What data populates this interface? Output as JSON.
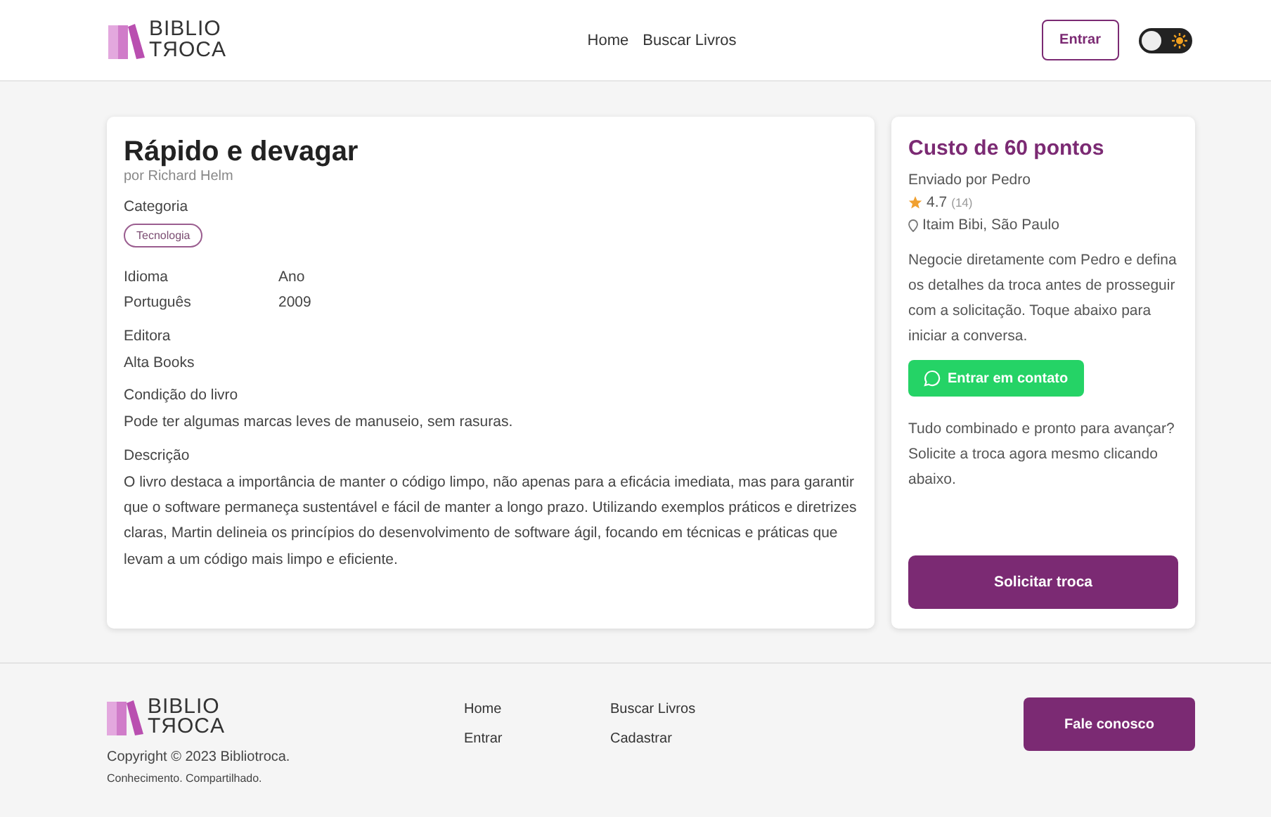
{
  "header": {
    "logo": [
      "BIBLIO",
      "TЯOCA"
    ],
    "nav": [
      "Home",
      "Buscar Livros"
    ],
    "login_button": "Entrar",
    "theme_toggle": {
      "on": false
    }
  },
  "book": {
    "title": "Rápido e devagar",
    "author": "por Richard Helm",
    "category_label": "Categoria",
    "category": "Tecnologia",
    "details": [
      {
        "label": "Idioma",
        "value": "Português"
      },
      {
        "label": "Ano",
        "value": "2009"
      }
    ],
    "sections": [
      {
        "label": "Editora",
        "value": "Alta Books"
      },
      {
        "label": "Condição do livro",
        "value": "Pode ter algumas marcas leves de manuseio, sem rasuras."
      },
      {
        "label": "Descrição",
        "value": "O livro destaca a importância de manter o código limpo, não apenas para a eficácia imediata, mas para garantir que o software permaneça sustentável e fácil de manter a longo prazo. Utilizando exemplos práticos e diretrizes claras, Martin delineia os princípios do desenvolvimento de software ágil, focando em técnicas e práticas que levam a um código mais limpo e eficiente."
      }
    ]
  },
  "offer": {
    "cost": "Custo de 60 pontos",
    "sender": "Enviado por Pedro",
    "rating": "4.7",
    "reviews": "(14)",
    "location": "Itaim Bibi, São Paulo",
    "negotiate_text": "Negocie diretamente com Pedro e defina os detalhes da troca antes de prosseguir com a solicitação. Toque abaixo para iniciar a conversa.",
    "contact_button": "Entrar em contato",
    "ready_text": "Tudo combinado e pronto para avançar? Solicite a troca agora mesmo clicando abaixo.",
    "request_button": "Solicitar troca"
  },
  "footer": {
    "logo": [
      "BIBLIO",
      "TЯOCA"
    ],
    "copyright": "Copyright © 2023 Bibliotroca.",
    "tagline": "Conhecimento. Compartilhado.",
    "links": [
      "Home",
      "Buscar Livros",
      "Entrar",
      "Cadastrar"
    ],
    "contact_button": "Fale conosco"
  }
}
